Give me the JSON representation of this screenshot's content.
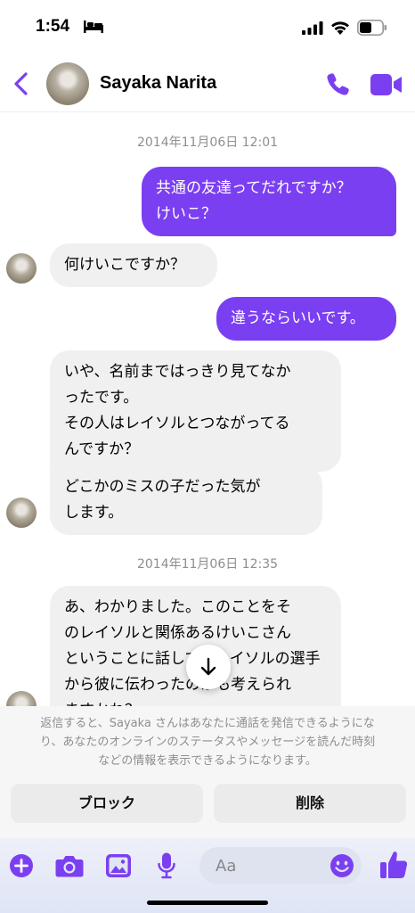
{
  "status_bar": {
    "time": "1:54"
  },
  "header": {
    "contact_name": "Sayaka Narita"
  },
  "messages": [
    {
      "type": "timestamp",
      "text": "2014年11月06日 12:01"
    },
    {
      "type": "outgoing",
      "lines": [
        "共通の友達ってだれですか？",
        "けいこ？"
      ]
    },
    {
      "type": "incoming",
      "lines": [
        "何けいこですか？"
      ]
    },
    {
      "type": "outgoing",
      "lines": [
        "違うならいいです。"
      ]
    },
    {
      "type": "incoming",
      "lines": [
        "いや、名前まではっきり見てなか",
        "ったです。",
        "その人はレイソルとつながってる",
        "んですか？"
      ]
    },
    {
      "type": "incoming",
      "lines": [
        "どこかのミスの子だった気が",
        "します。"
      ]
    },
    {
      "type": "timestamp",
      "text": "2014年11月06日 12:35"
    },
    {
      "type": "incoming",
      "lines": [
        "あ、わかりました。このことをそ",
        "のレイソルと関係あるけいこさん",
        "ということに話して、レイソルの選手",
        "から彼に伝わったのかも考えられ",
        "ますかね？"
      ]
    }
  ],
  "notice": {
    "lines": [
      "返信すると、Sayaka さんはあなたに通話を発信できるようにな",
      "り、あなたのオンラインのステータスやメッセージを読んだ時刻",
      "などの情報を表示できるようになります。"
    ],
    "block_label": "ブロック",
    "delete_label": "削除"
  },
  "composer": {
    "placeholder": "Aa"
  },
  "colors": {
    "accent": "#7b3ff2",
    "incoming_bubble": "#f0f0f0"
  },
  "icons": [
    "bed-icon",
    "signal-icon",
    "wifi-icon",
    "battery-icon",
    "back-chevron-icon",
    "phone-icon",
    "video-icon",
    "arrow-down-icon",
    "plus-icon",
    "camera-icon",
    "image-icon",
    "mic-icon",
    "emoji-icon",
    "thumbs-up-icon"
  ]
}
